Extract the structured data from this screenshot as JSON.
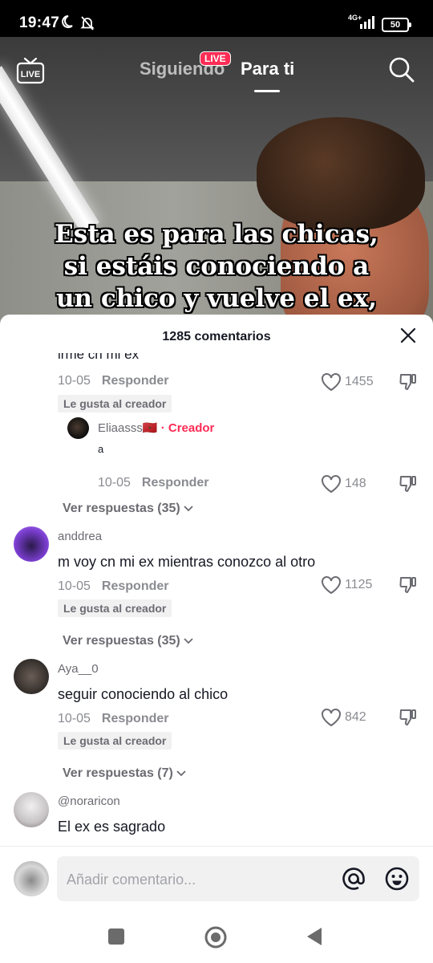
{
  "status_bar": {
    "time": "19:47",
    "network": "4G+",
    "battery": "50"
  },
  "top_nav": {
    "live_label": "LIVE",
    "tab_following": "Siguiendo",
    "live_badge": "LIVE",
    "tab_for_you": "Para ti"
  },
  "video": {
    "caption_lines": [
      "Esta es para las chicas,",
      "si estáis conociendo a",
      "un chico y vuelve el ex,"
    ]
  },
  "comments_sheet": {
    "title": "1285 comentarios",
    "partial_comment_text": "irme cn mi ex",
    "comments": [
      {
        "date": "10-05",
        "reply_label": "Responder",
        "likes": "1455",
        "badge": "Le gusta al creador"
      },
      {
        "username": "Eliaasss🇲🇦",
        "creator_tag": "· Creador",
        "text": "a",
        "date": "10-05",
        "reply_label": "Responder",
        "likes": "148",
        "view_replies": "Ver respuestas (35)"
      },
      {
        "username": "anddrea",
        "text": "m voy cn mi ex mientras conozco al otro",
        "date": "10-05",
        "reply_label": "Responder",
        "likes": "1125",
        "badge": "Le gusta al creador",
        "view_replies": "Ver respuestas (35)"
      },
      {
        "username": "Aya__0",
        "text": "seguir conociendo al chico",
        "date": "10-05",
        "reply_label": "Responder",
        "likes": "842",
        "badge": "Le gusta al creador",
        "view_replies": "Ver respuestas (7)"
      },
      {
        "username": "@noraricon",
        "text": "El ex es sagrado"
      }
    ]
  },
  "input": {
    "placeholder": "Añadir comentario..."
  }
}
